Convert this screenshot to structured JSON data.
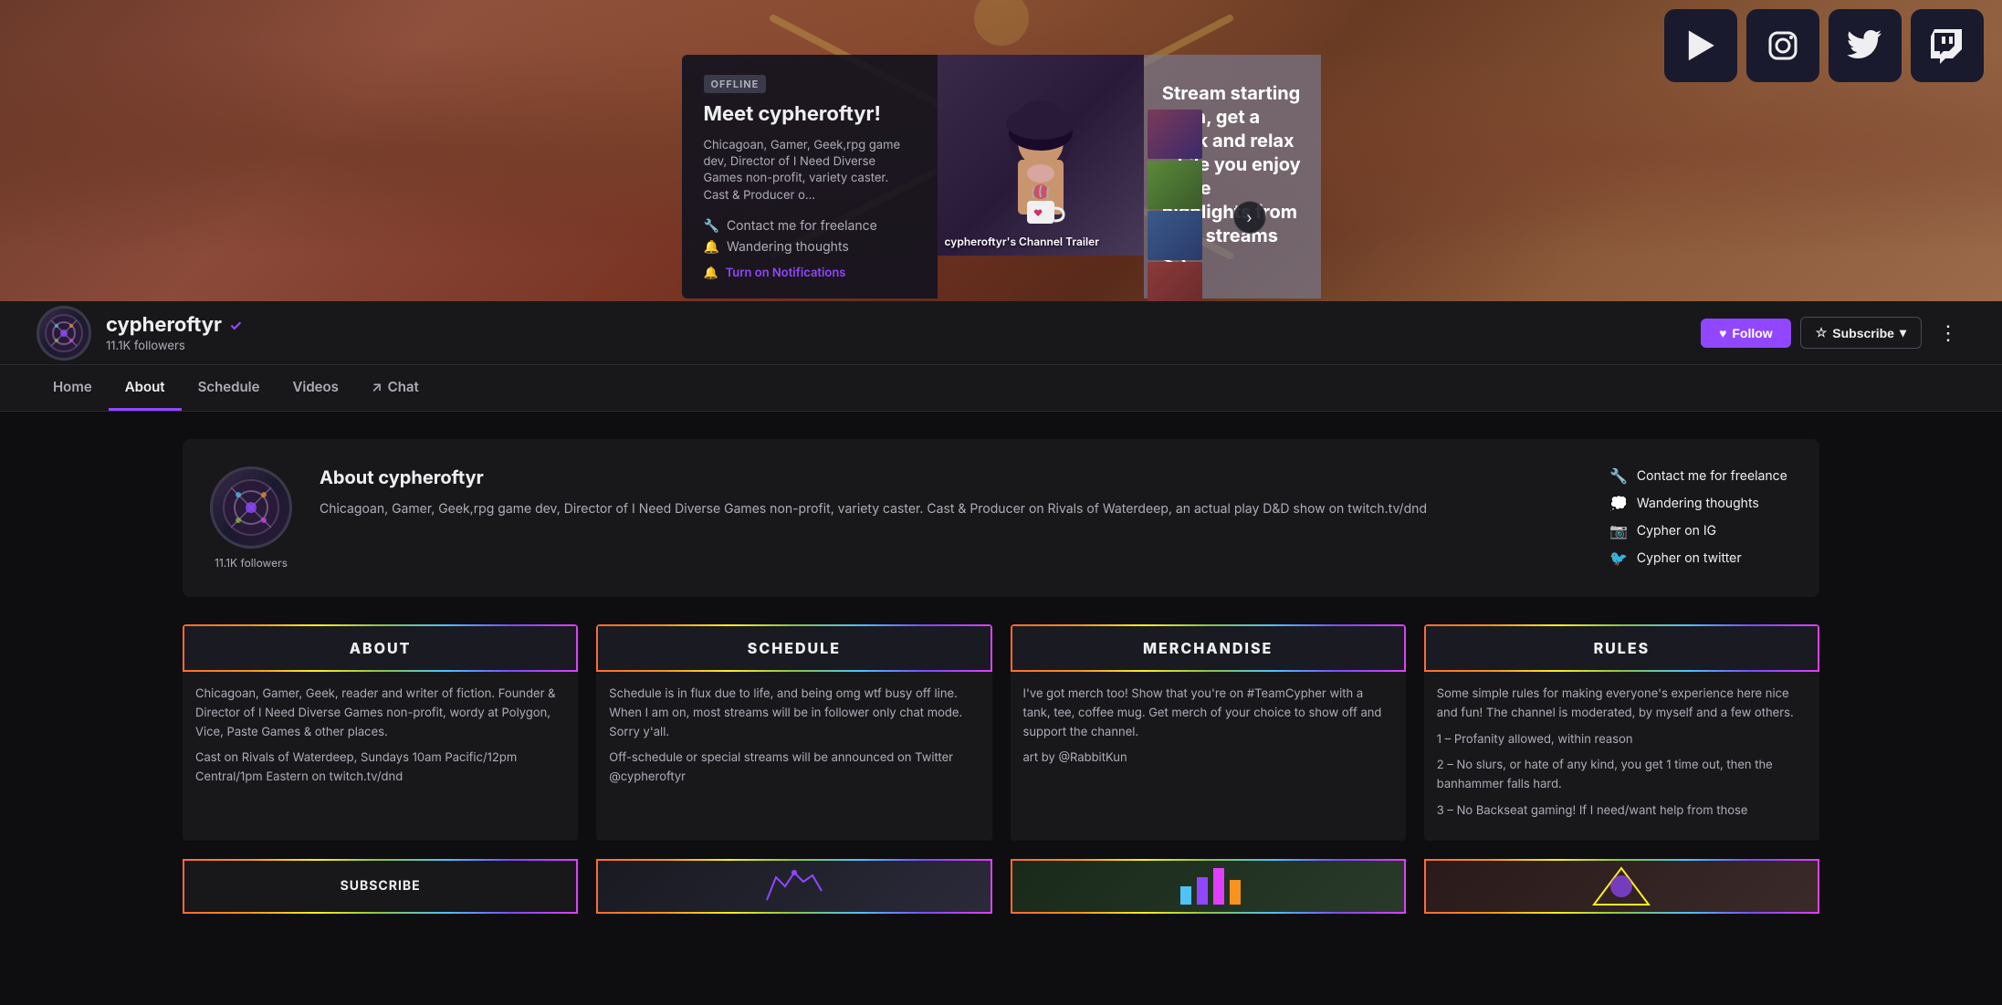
{
  "banner": {
    "social_icons": [
      {
        "name": "youtube-icon",
        "symbol": "▶",
        "label": "YouTube"
      },
      {
        "name": "instagram-icon",
        "symbol": "📷",
        "label": "Instagram"
      },
      {
        "name": "twitter-icon",
        "symbol": "🐦",
        "label": "Twitter"
      },
      {
        "name": "twitch-icon",
        "symbol": "📺",
        "label": "Twitch"
      }
    ],
    "offline_panel": {
      "badge": "OFFLINE",
      "title": "Meet cypheroftyr!",
      "description": "Chicagoan, Gamer, Geek,rpg game dev, Director of I Need Diverse Games non-profit, variety caster. Cast & Producer o...",
      "link1": "Contact me for freelance",
      "link2": "Wandering thoughts",
      "notif_btn": "Turn on Notifications"
    },
    "video": {
      "label": "cypheroftyr's Channel Trailer"
    },
    "stream_text": "Stream starting soon, get a drink and relax while you enjoy some highlights from past streams <3"
  },
  "channel": {
    "name": "cypheroftyr",
    "verified": "✓",
    "followers": "11.1K followers",
    "avatar_symbol": "⚙",
    "follow_label": "Follow",
    "subscribe_label": "Subscribe",
    "more_label": "⋮"
  },
  "nav": {
    "tabs": [
      {
        "label": "Home",
        "id": "home",
        "active": false
      },
      {
        "label": "About",
        "id": "about",
        "active": true
      },
      {
        "label": "Schedule",
        "id": "schedule",
        "active": false
      },
      {
        "label": "Videos",
        "id": "videos",
        "active": false
      },
      {
        "label": "↗ Chat",
        "id": "chat",
        "active": false
      }
    ]
  },
  "about": {
    "title": "About cypheroftyr",
    "description": "Chicagoan, Gamer, Geek,rpg game dev, Director of I Need Diverse Games non-profit, variety caster. Cast & Producer on Rivals of Waterdeep, an actual play D&D show on twitch.tv/dnd",
    "followers_label": "11.1K followers",
    "links": [
      {
        "icon": "🔧",
        "text": "Contact me for freelance"
      },
      {
        "icon": "💭",
        "text": "Wandering thoughts"
      },
      {
        "icon": "📷",
        "text": "Cypher on IG"
      },
      {
        "icon": "🐦",
        "text": "Cypher on twitter"
      }
    ]
  },
  "panels": [
    {
      "header": "ABOUT",
      "body": "Chicagoan, Gamer, Geek, reader and writer of fiction. Founder & Director of I Need Diverse Games non-profit, wordy at Polygon, Vice, Paste Games & other places.\n\nCast on Rivals of Waterdeep, Sundays 10am Pacific/12pm Central/1pm Eastern on twitch.tv/dnd"
    },
    {
      "header": "SCHEDULE",
      "body": "Schedule is in flux due to life, and being omg wtf busy off line. When I am on, most streams will be in follower only chat mode. Sorry y'all.\n\nOff-schedule or special streams will be announced on Twitter @cypheroftyr"
    },
    {
      "header": "MERCHANDISE",
      "body": "I've got merch too! Show that you're on #TeamCypher with a tank, tee, coffee mug. Get merch of your choice to show off and support the channel.\n\nart by @RabbitKun"
    },
    {
      "header": "RULES",
      "body": "Some simple rules for making everyone's experience here nice and fun! The channel is moderated, by myself and a few others.\n\n1 – Profanity allowed, within reason\n\n2 – No slurs, or hate of any kind, you get 1 time out, then the banhammer falls hard.\n\n3 – No Backseat gaming! If I need/want help from those"
    }
  ],
  "panels_row2": [
    {
      "header": "SUBSCRIBE"
    },
    {
      "header": ""
    },
    {
      "header": ""
    },
    {
      "header": ""
    }
  ],
  "colors": {
    "purple": "#9147ff",
    "bg_dark": "#0e0e10",
    "bg_panel": "#18181b",
    "text_muted": "#adadb8"
  }
}
